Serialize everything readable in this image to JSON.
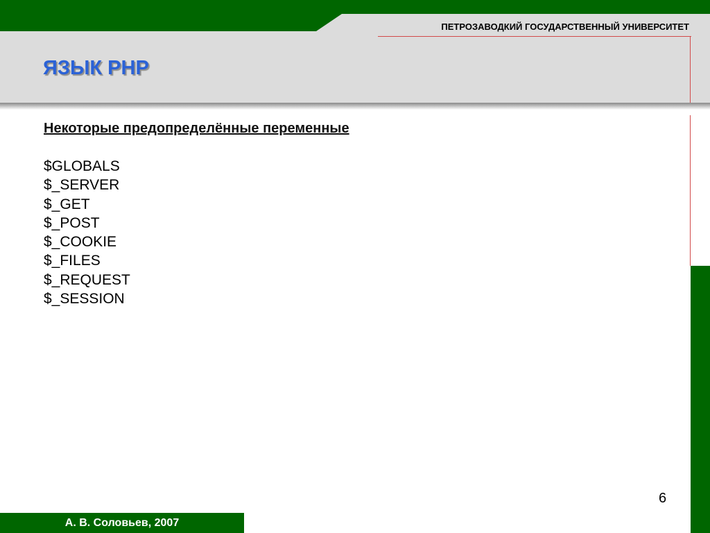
{
  "header": {
    "university": "ПЕТРОЗАВОДКИЙ ГОСУДАРСТВЕННЫЙ УНИВЕРСИТЕТ",
    "title": "ЯЗЫК PHP"
  },
  "content": {
    "heading": "Некоторые предопределённые переменные",
    "variables": [
      "$GLOBALS",
      "$_SERVER",
      "$_GET",
      "$_POST",
      "$_COOKIE",
      "$_FILES",
      "$_REQUEST",
      "$_SESSION"
    ]
  },
  "footer": {
    "author": "А. В. Соловьев, 2007",
    "page_number": "6"
  },
  "colors": {
    "brand_green": "#006600",
    "title_blue": "#2b62d6",
    "rule_red": "#d24a4a"
  }
}
